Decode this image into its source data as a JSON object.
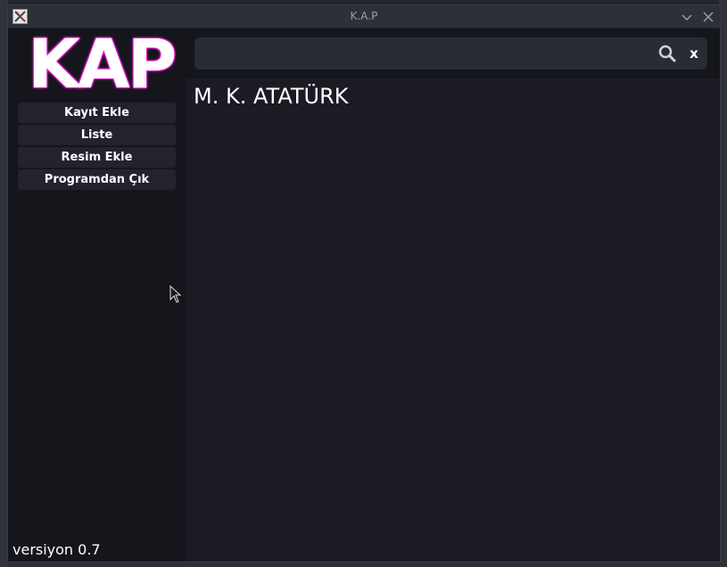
{
  "window": {
    "title": "K.A.P"
  },
  "sidebar": {
    "logo": "KAP",
    "menu": [
      {
        "label": "Kayıt Ekle"
      },
      {
        "label": "Liste"
      },
      {
        "label": "Resim Ekle"
      },
      {
        "label": "Programdan Çık"
      }
    ],
    "version": "versiyon 0.7"
  },
  "search": {
    "value": "",
    "placeholder": "",
    "clear_label": "x",
    "icon": "search-icon"
  },
  "results": [
    {
      "text": "M. K. ATATÜRK"
    }
  ],
  "colors": {
    "window_bg": "#15161c",
    "content_bg": "#1a1b23",
    "button_bg": "#22232d",
    "search_bg": "#2a2c34",
    "logo_glow": "#ff2fe0"
  }
}
